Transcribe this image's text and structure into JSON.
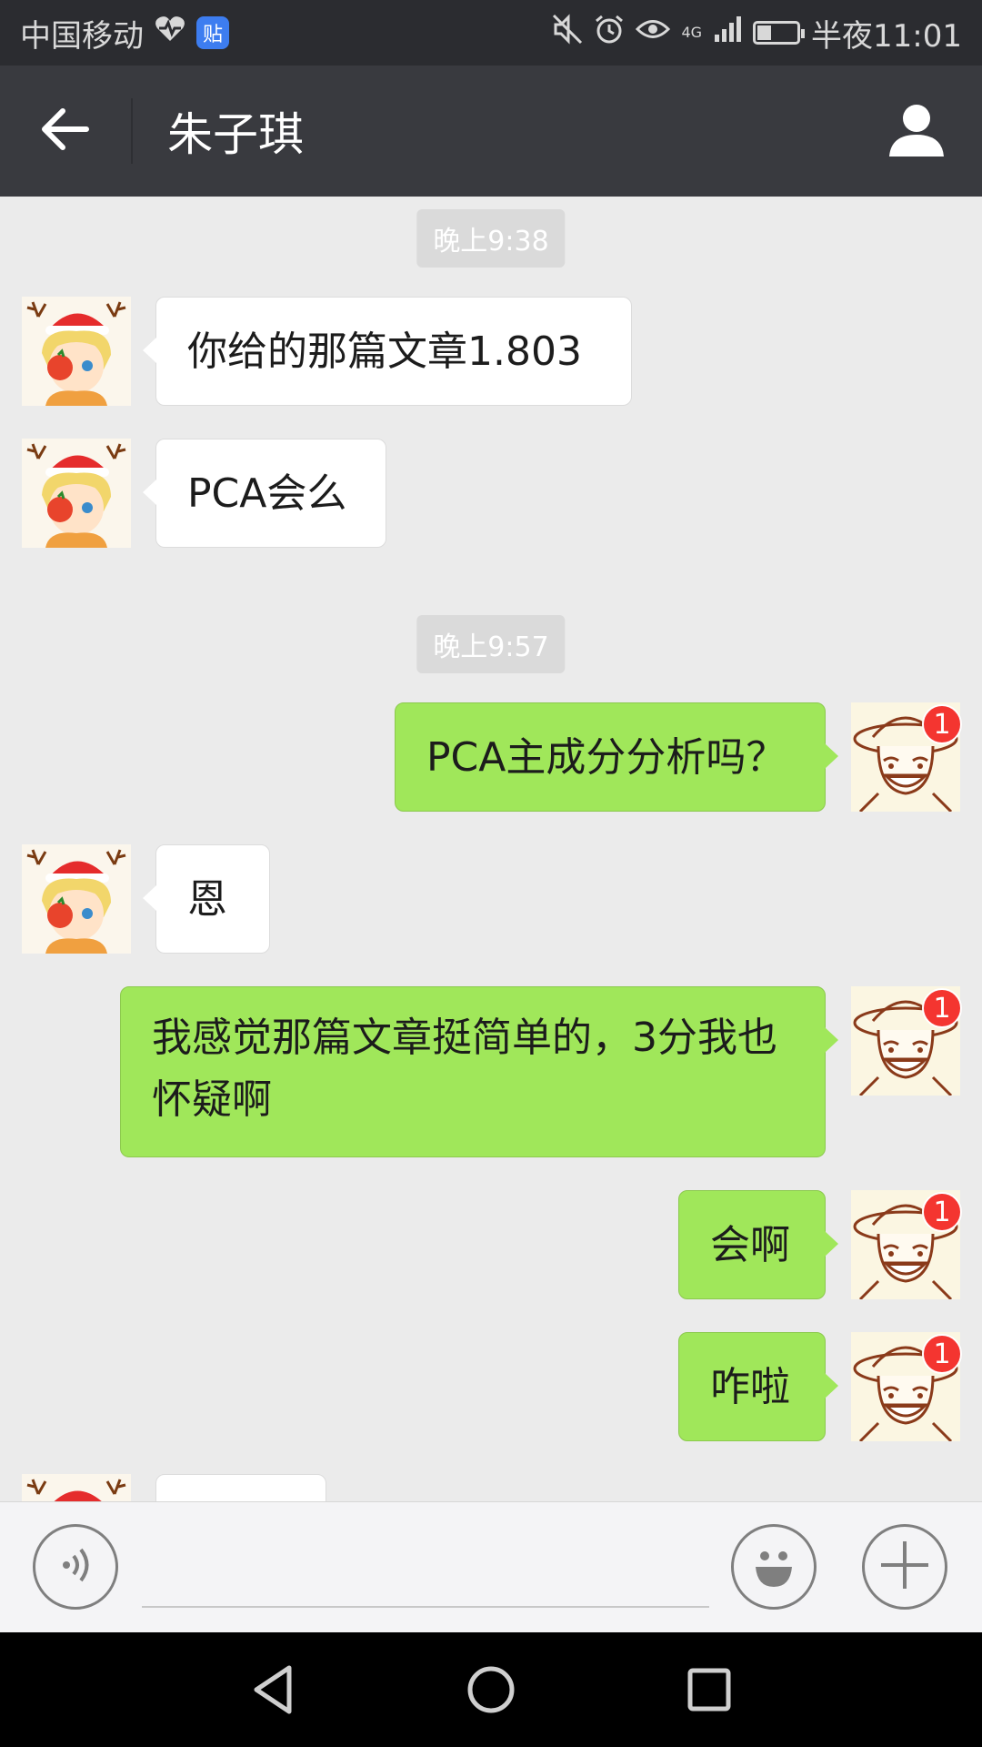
{
  "status_bar": {
    "carrier": "中国移动",
    "app_badge": "贴",
    "network": "4G",
    "time": "半夜11:01",
    "battery_level": 0.35,
    "icons": [
      "heart-icon",
      "mute-icon",
      "alarm-icon",
      "eye-icon",
      "signal-icon",
      "battery-icon"
    ]
  },
  "header": {
    "title": "朱子琪",
    "icons": [
      "back-arrow-icon",
      "person-icon"
    ]
  },
  "messages": {
    "time1": "晚上9:38",
    "m1": "你给的那篇文章1.803",
    "m2": "PCA会么",
    "time2": "晚上9:57",
    "m3": "PCA主成分分析吗？",
    "m4": "恩",
    "m5": "我感觉那篇文章挺简单的，3分我也怀疑啊",
    "m6": "会啊",
    "m7": "咋啦",
    "unread_badge": "1"
  },
  "input_bar": {
    "value": "",
    "icons": [
      "voice-icon",
      "emoji-icon",
      "plus-icon"
    ]
  },
  "nav_bar": {
    "icons": [
      "nav-back-icon",
      "nav-home-icon",
      "nav-recents-icon"
    ]
  },
  "colors": {
    "status_bar_bg": "#2b2c30",
    "title_bar_bg": "#393a3f",
    "chat_bg": "#ebebeb",
    "outgoing_bubble": "#a0e75a",
    "incoming_bubble": "#ffffff",
    "badge": "#f43530"
  }
}
